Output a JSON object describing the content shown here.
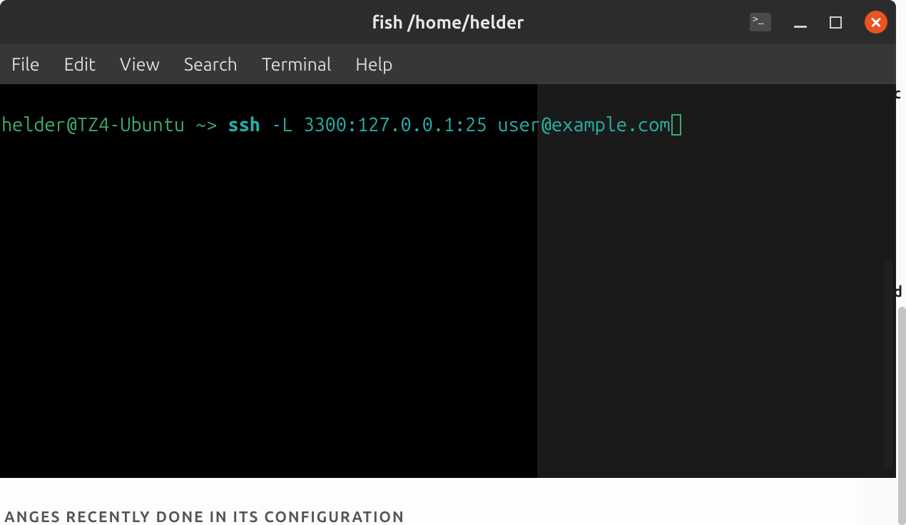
{
  "window": {
    "title": "fish  /home/helder"
  },
  "menubar": {
    "items": [
      "File",
      "Edit",
      "View",
      "Search",
      "Terminal",
      "Help"
    ]
  },
  "terminal": {
    "prompt": "helder@TZ4-Ubuntu ~> ",
    "command": "ssh",
    "args": " -L 3300:127.0.0.1:25 user@example.com"
  },
  "background": {
    "bottom_text": "ANGES RECENTLY DONE IN ITS CONFIGURATION",
    "side_text1": "Dc",
    "side_text2": "Ad"
  },
  "colors": {
    "titlebar": "#2c2c2c",
    "menubar": "#373737",
    "terminal_bg": "#000000",
    "prompt": "#3fa86f",
    "command": "#24b0a8",
    "close_btn": "#e95420"
  }
}
